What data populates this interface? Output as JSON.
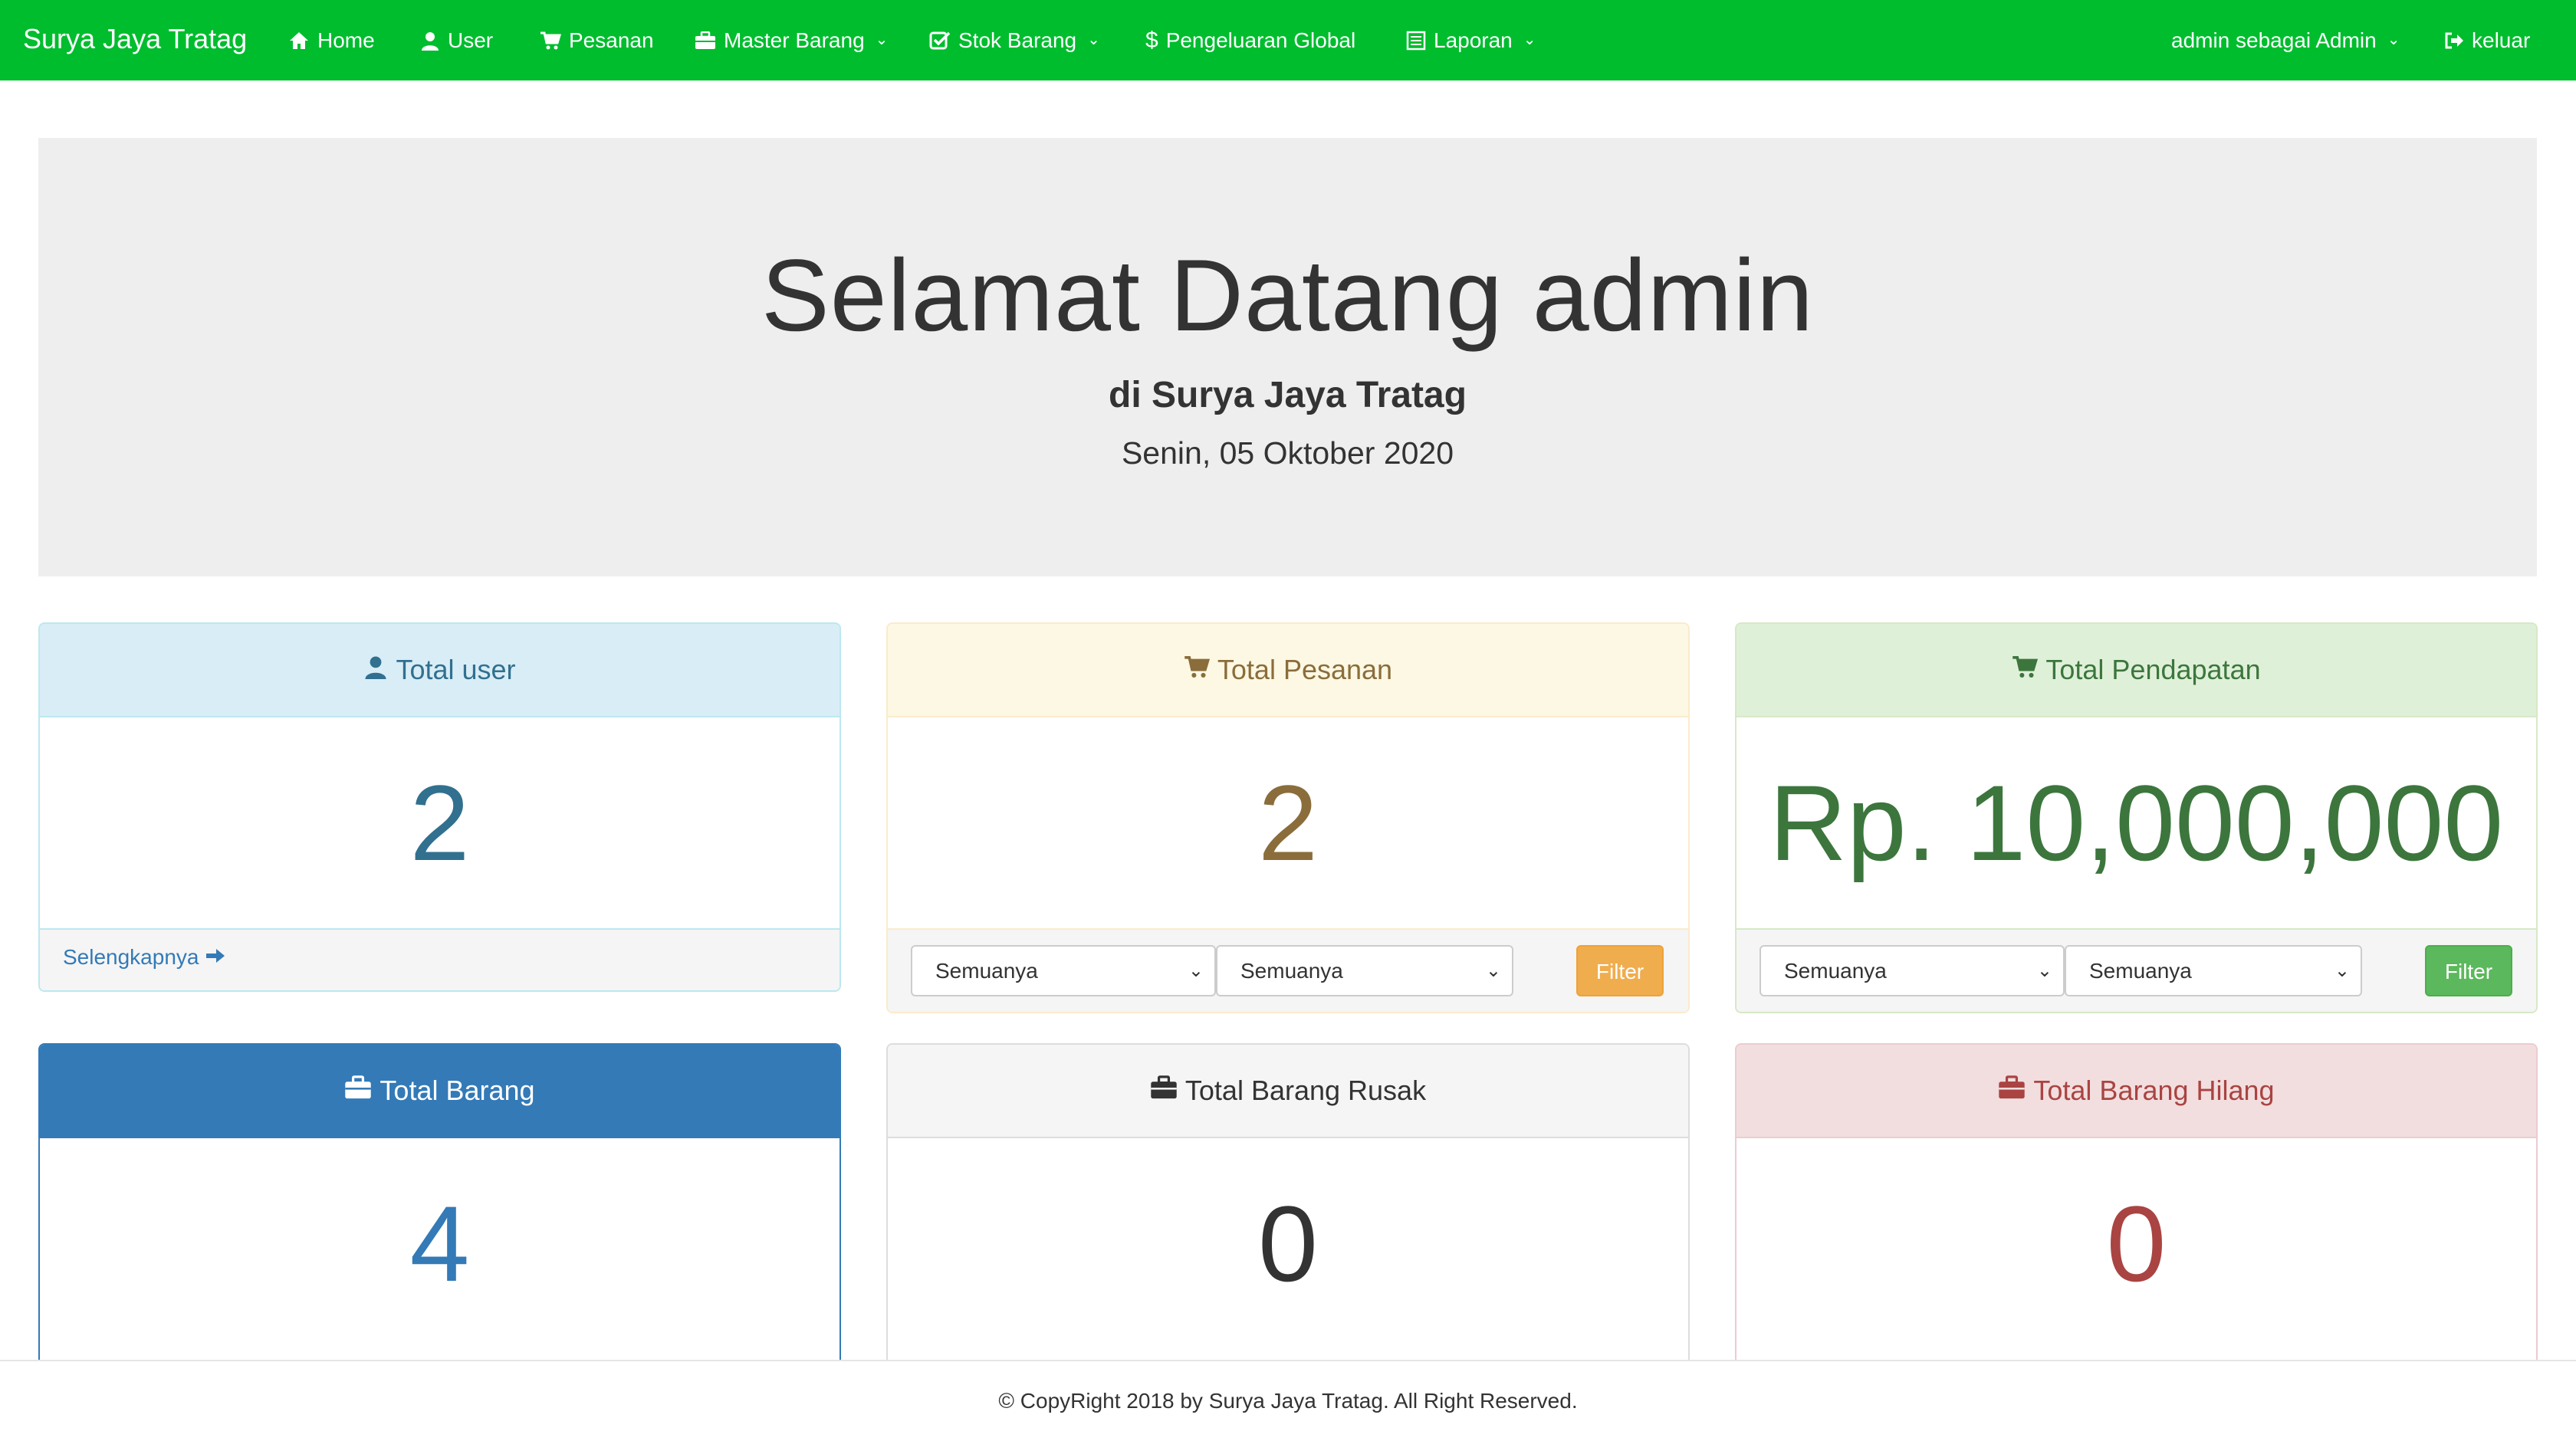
{
  "navbar": {
    "brand": "Surya Jaya Tratag",
    "items": [
      {
        "label": "Home",
        "icon": "home-icon"
      },
      {
        "label": "User",
        "icon": "user-icon"
      },
      {
        "label": "Pesanan",
        "icon": "cart-icon"
      },
      {
        "label": "Master Barang",
        "icon": "briefcase-icon",
        "dropdown": true
      },
      {
        "label": "Stok Barang",
        "icon": "check-square-icon",
        "dropdown": true
      },
      {
        "label": "Pengeluaran Global",
        "icon": "dollar-icon"
      },
      {
        "label": "Laporan",
        "icon": "list-alt-icon",
        "dropdown": true
      }
    ],
    "account": {
      "label": "admin sebagai Admin",
      "dropdown": true
    },
    "logout": {
      "label": "keluar",
      "icon": "logout-icon"
    },
    "color": "#00bd2e"
  },
  "jumbotron": {
    "title": "Selamat Datang admin",
    "subtitle": "di Surya Jaya Tratag",
    "date": "Senin, 05 Oktober 2020"
  },
  "cards": {
    "total_user": {
      "title": "Total user",
      "value": "2",
      "link": "Selengkapnya"
    },
    "total_pesanan": {
      "title": "Total Pesanan",
      "value": "2",
      "select1": "Semuanya",
      "select2": "Semuanya",
      "button": "Filter",
      "button_color": "#f0ad4e"
    },
    "total_pendapatan": {
      "title": "Total Pendapatan",
      "value": "Rp. 10,000,000",
      "select1": "Semuanya",
      "select2": "Semuanya",
      "button": "Filter",
      "button_color": "#5cb85c"
    },
    "total_barang": {
      "title": "Total Barang",
      "value": "4"
    },
    "total_barang_rusak": {
      "title": "Total Barang Rusak",
      "value": "0"
    },
    "total_barang_hilang": {
      "title": "Total Barang Hilang",
      "value": "0"
    }
  },
  "footer": {
    "text": "© CopyRight 2018 by Surya Jaya Tratag. All Right Reserved."
  }
}
